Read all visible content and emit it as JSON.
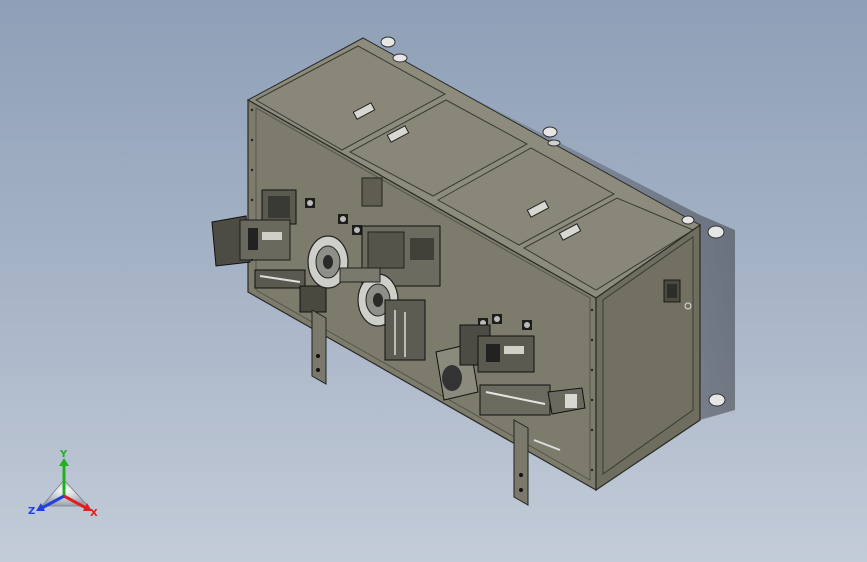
{
  "viewport": {
    "name": "3d-model-viewport"
  },
  "triad": {
    "x_label": "X",
    "y_label": "Y",
    "z_label": "Z",
    "x_color": "#e02020",
    "y_color": "#20b020",
    "z_color": "#2040e0"
  },
  "colors": {
    "background_top": "#8e9fb7",
    "background_bottom": "#c3ccd8",
    "panel_face": "#7d7c6c",
    "panel_top": "#8d8c7c",
    "panel_side": "#6e6d5e",
    "edge": "#2a2a26"
  }
}
